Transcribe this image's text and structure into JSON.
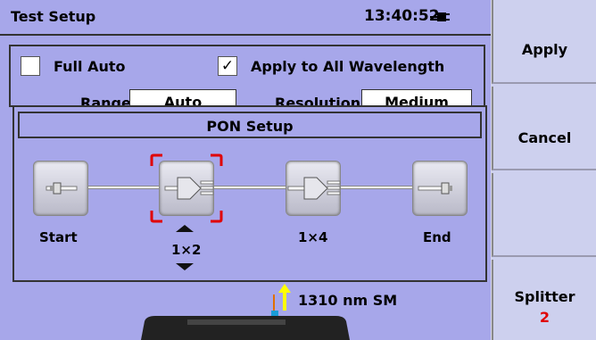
{
  "header": {
    "title": "Test Setup",
    "clock": "13:40:52"
  },
  "options": {
    "full_auto": {
      "label": "Full Auto",
      "checked": false
    },
    "apply_all": {
      "label": "Apply to All Wavelength",
      "checked": true,
      "check_mark": "✓"
    },
    "range_label": "Range",
    "range_value": "Auto",
    "resolution_label": "Resolution",
    "resolution_value": "Medium"
  },
  "pon": {
    "title": "PON Setup",
    "nodes": [
      {
        "label": "Start"
      },
      {
        "label": "1×2",
        "selected": true
      },
      {
        "label": "1×4"
      },
      {
        "label": "End"
      }
    ]
  },
  "bottom": {
    "wavelength": "1310 nm SM"
  },
  "menu": {
    "apply": "Apply",
    "cancel": "Cancel",
    "blank": "",
    "splitter": "Splitter",
    "splitter_value": "2"
  },
  "colors": {
    "selection": "#e00000",
    "accent": "#a7a7ea",
    "splitter_value": "#e00000",
    "arrow": "#ffff00"
  }
}
